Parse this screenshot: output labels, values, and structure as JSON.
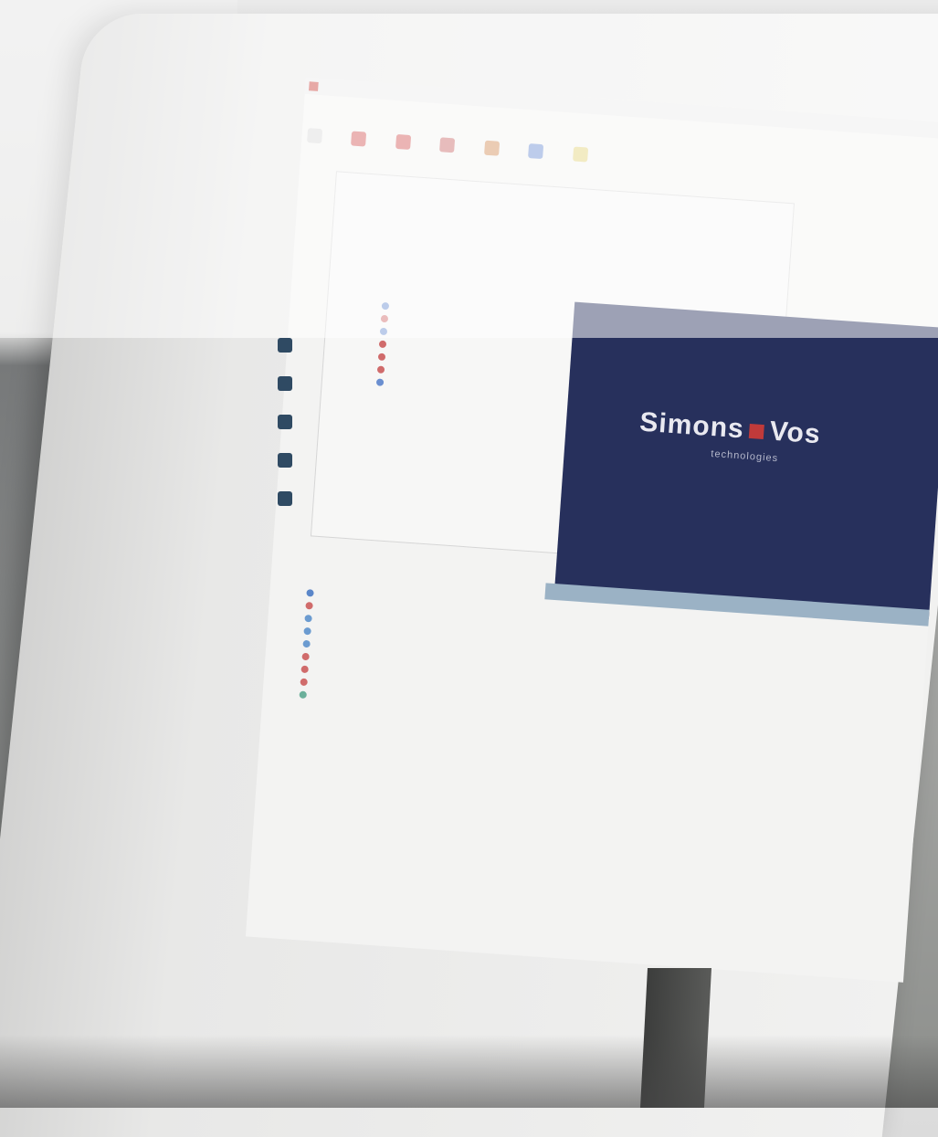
{
  "scene": {
    "colors": {
      "logo_background": "#27305c",
      "logo_red": "#c03a3a",
      "grid_header": "#9bb2c5"
    }
  },
  "logo": {
    "brand_left": "Simons",
    "brand_right": "Vos",
    "tagline": "technologies"
  }
}
